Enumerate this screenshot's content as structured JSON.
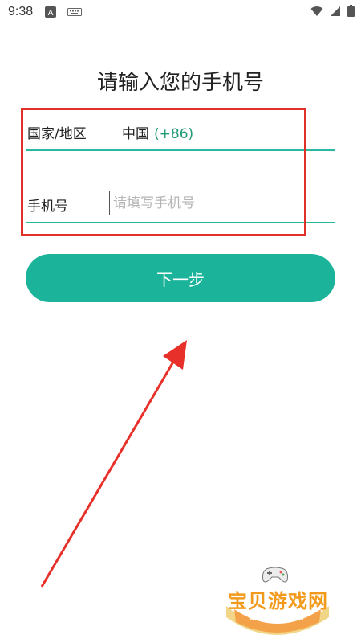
{
  "status_bar": {
    "time": "9:38"
  },
  "page": {
    "title": "请输入您的手机号"
  },
  "form": {
    "country_label": "国家/地区",
    "country_name": "中国",
    "country_code": "(+86)",
    "phone_label": "手机号",
    "phone_value": "",
    "phone_placeholder": "请填写手机号"
  },
  "next_button": {
    "label": "下一步"
  },
  "watermark": {
    "name": "宝贝游戏网",
    "url": "baobeiy.com"
  },
  "colors": {
    "accent": "#1bb39a",
    "underline": "#29b8a1",
    "annotation_red": "#e0302a",
    "country_code": "#1f9a76"
  },
  "icons": [
    "font-a-icon",
    "keyboard-icon",
    "wifi-icon",
    "cellular-signal-icon",
    "battery-icon",
    "annotation-arrow-icon",
    "gamepad-icon"
  ]
}
